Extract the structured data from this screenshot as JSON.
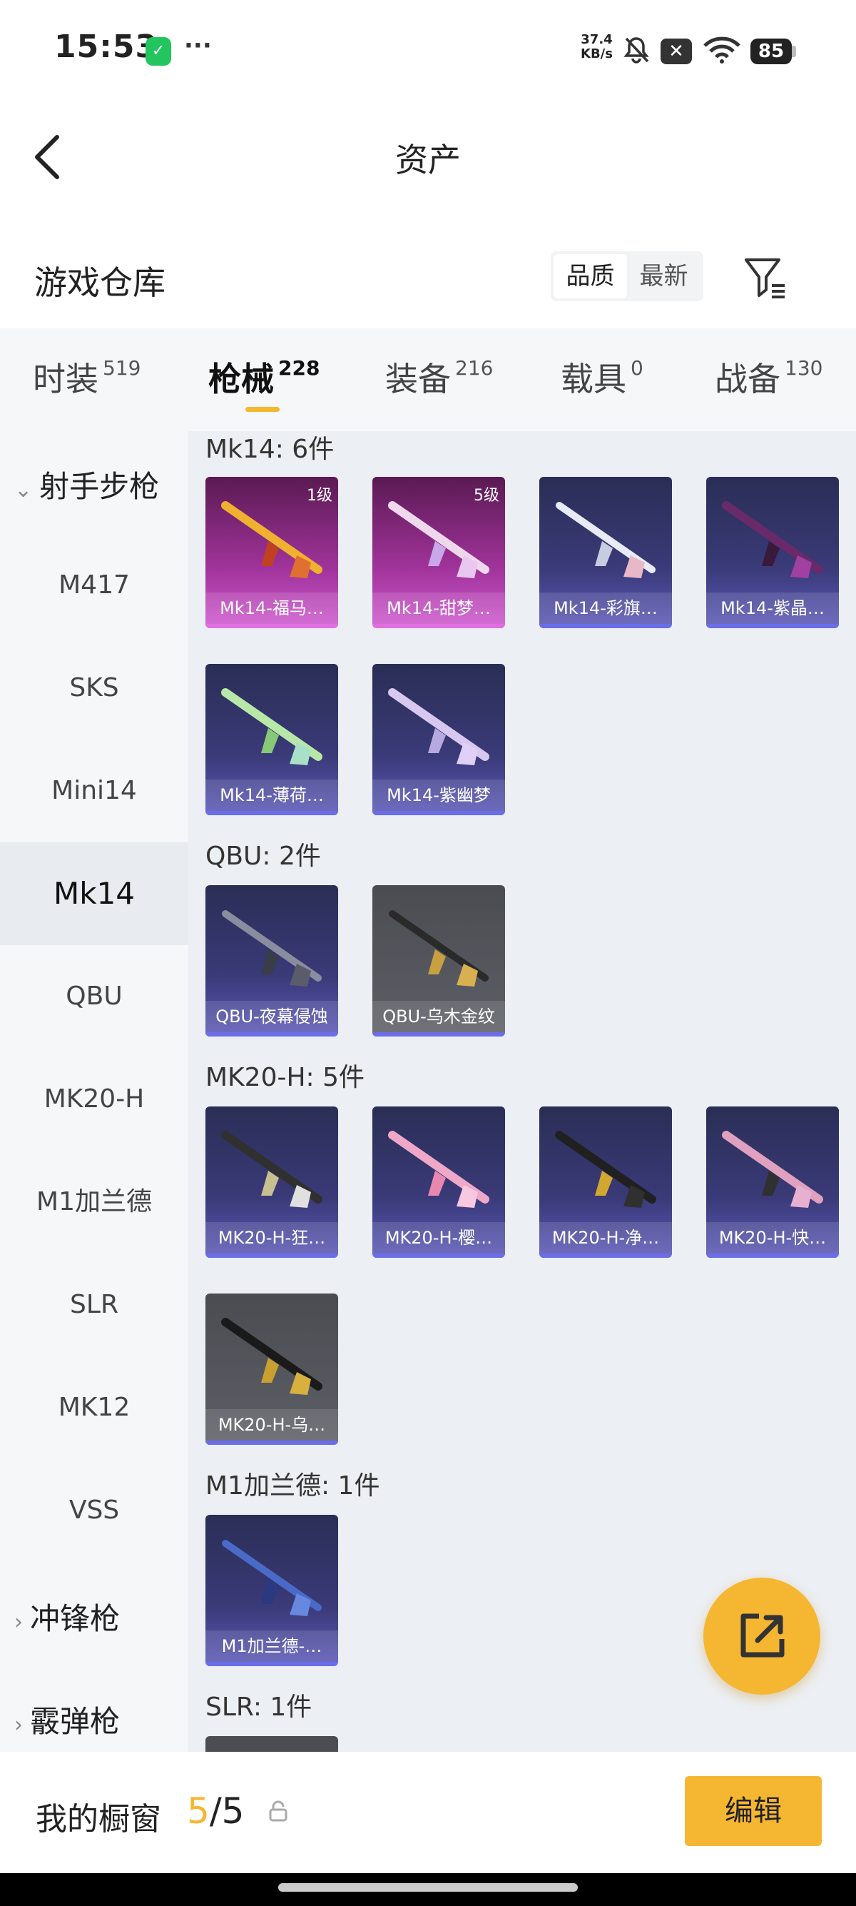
{
  "status_bar": {
    "time": "15:53",
    "speed_value": "37.4",
    "speed_unit": "KB/s",
    "battery": "85"
  },
  "header": {
    "title": "资产"
  },
  "warehouse": {
    "title": "游戏仓库",
    "sort_options": [
      "品质",
      "最新"
    ],
    "active_sort": "品质"
  },
  "tabs": [
    {
      "label": "时装",
      "count": "519"
    },
    {
      "label": "枪械",
      "count": "228"
    },
    {
      "label": "装备",
      "count": "216"
    },
    {
      "label": "载具",
      "count": "0"
    },
    {
      "label": "战备",
      "count": "130"
    }
  ],
  "sidebar": {
    "category_top": "射手步枪",
    "items": [
      "M417",
      "SKS",
      "Mini14",
      "Mk14",
      "QBU",
      "MK20-H",
      "M1加兰德",
      "SLR",
      "MK12",
      "VSS"
    ],
    "active_item": "Mk14",
    "category_smg": "冲锋枪",
    "category_shotgun": "霰弹枪"
  },
  "groups": [
    {
      "title": "Mk14: 6件",
      "items": [
        {
          "label": "Mk14-福马…",
          "level": "1级",
          "style": "pink"
        },
        {
          "label": "Mk14-甜梦…",
          "level": "5级",
          "style": "pink"
        },
        {
          "label": "Mk14-彩旗…",
          "level": "",
          "style": "blue"
        },
        {
          "label": "Mk14-紫晶…",
          "level": "",
          "style": "blue"
        },
        {
          "label": "Mk14-薄荷…",
          "level": "",
          "style": "blue"
        },
        {
          "label": "Mk14-紫幽梦",
          "level": "",
          "style": "blue"
        }
      ]
    },
    {
      "title": "QBU: 2件",
      "items": [
        {
          "label": "QBU-夜幕侵蚀",
          "level": "",
          "style": "blue"
        },
        {
          "label": "QBU-乌木金纹",
          "level": "",
          "style": "gray"
        }
      ]
    },
    {
      "title": "MK20-H: 5件",
      "items": [
        {
          "label": "MK20-H-狂…",
          "level": "",
          "style": "blue"
        },
        {
          "label": "MK20-H-樱…",
          "level": "",
          "style": "blue"
        },
        {
          "label": "MK20-H-净…",
          "level": "",
          "style": "blue"
        },
        {
          "label": "MK20-H-快…",
          "level": "",
          "style": "blue"
        },
        {
          "label": "MK20-H-乌…",
          "level": "",
          "style": "gray"
        }
      ]
    },
    {
      "title": "M1加兰德: 1件",
      "items": [
        {
          "label": "M1加兰德-…",
          "level": "",
          "style": "blue"
        }
      ]
    },
    {
      "title": "SLR: 1件",
      "items": []
    }
  ],
  "bottom": {
    "showcase_label": "我的橱窗",
    "used": "5",
    "total": "/5",
    "edit_label": "编辑"
  },
  "colors": {
    "accent": "#f5b731",
    "card_blue": "#3a3a78",
    "card_pink": "#a0339a",
    "card_gray": "#5d5f66"
  }
}
